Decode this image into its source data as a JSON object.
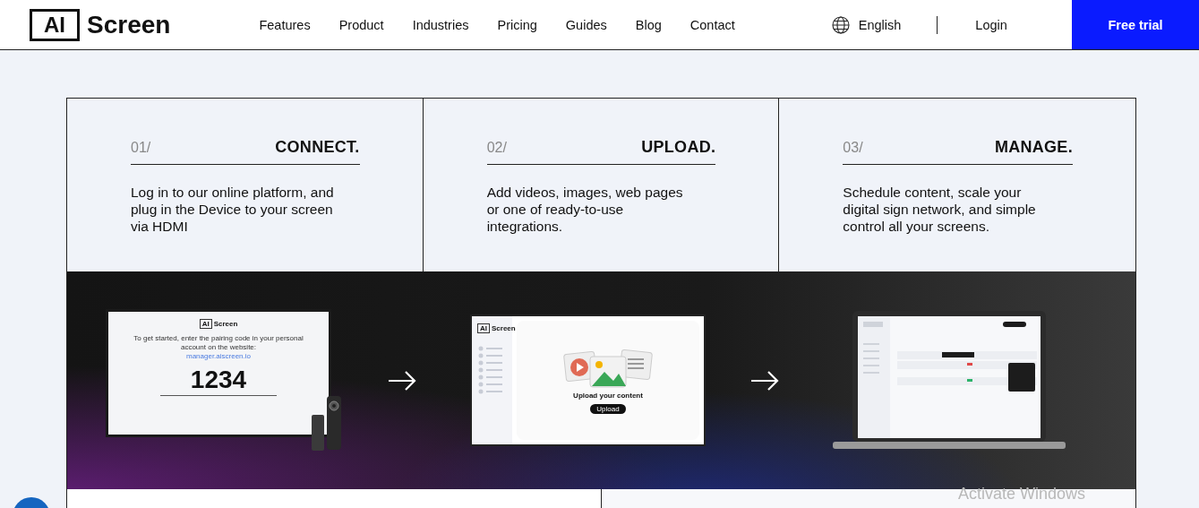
{
  "header": {
    "logo_mark": "AI",
    "logo_text": "Screen",
    "nav": [
      "Features",
      "Product",
      "Industries",
      "Pricing",
      "Guides",
      "Blog",
      "Contact"
    ],
    "language": "English",
    "login": "Login",
    "cta": "Free trial"
  },
  "steps": [
    {
      "number": "01/",
      "title": "CONNECT.",
      "text": "Log in to our online platform, and plug in the Device to your screen via HDMI"
    },
    {
      "number": "02/",
      "title": "UPLOAD.",
      "text": "Add videos, images, web pages or one of ready-to-use integrations."
    },
    {
      "number": "03/",
      "title": "MANAGE.",
      "text": "Schedule content, scale your digital sign network, and simple control all your screens."
    }
  ],
  "showcase": {
    "pairing": {
      "logo_mark": "AI",
      "logo_text": "Screen",
      "instruction": "To get started, enter the pairing code in your personal account on the website:",
      "link": "manager.aiscreen.io",
      "code": "1234"
    },
    "upload": {
      "logo_mark": "AI",
      "logo_text": "Screen",
      "heading": "Upload your content",
      "button": "Upload"
    }
  },
  "os_overlay": "Activate Windows"
}
